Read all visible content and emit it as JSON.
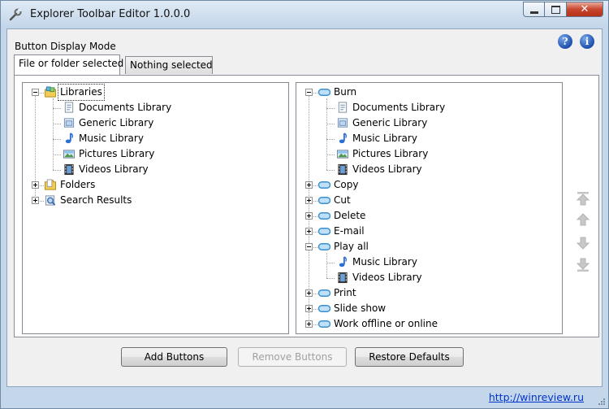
{
  "window": {
    "title": "Explorer Toolbar Editor 1.0.0.0"
  },
  "mode_label": "Button Display Mode",
  "tabs": [
    {
      "label": "File or folder selected",
      "active": true
    },
    {
      "label": "Nothing selected",
      "active": false
    }
  ],
  "left_tree": [
    {
      "label": "Libraries",
      "icon": "libraries-icon",
      "level": 0,
      "expanded": true,
      "selected": true
    },
    {
      "label": "Documents Library",
      "icon": "document-library-icon",
      "level": 1
    },
    {
      "label": "Generic Library",
      "icon": "generic-library-icon",
      "level": 1
    },
    {
      "label": "Music Library",
      "icon": "music-note-icon",
      "level": 1
    },
    {
      "label": "Pictures Library",
      "icon": "pictures-library-icon",
      "level": 1
    },
    {
      "label": "Videos Library",
      "icon": "film-icon",
      "level": 1
    },
    {
      "label": "Folders",
      "icon": "folder-icon",
      "level": 0,
      "expanded": false
    },
    {
      "label": "Search Results",
      "icon": "search-results-icon",
      "level": 0,
      "expanded": false
    }
  ],
  "right_tree": [
    {
      "label": "Burn",
      "icon": "toolbar-button-icon",
      "level": 0,
      "expanded": true
    },
    {
      "label": "Documents Library",
      "icon": "document-library-icon",
      "level": 1
    },
    {
      "label": "Generic Library",
      "icon": "generic-library-icon",
      "level": 1
    },
    {
      "label": "Music Library",
      "icon": "music-note-icon",
      "level": 1
    },
    {
      "label": "Pictures Library",
      "icon": "pictures-library-icon",
      "level": 1
    },
    {
      "label": "Videos Library",
      "icon": "film-icon",
      "level": 1
    },
    {
      "label": "Copy",
      "icon": "toolbar-button-icon",
      "level": 0,
      "expanded": false
    },
    {
      "label": "Cut",
      "icon": "toolbar-button-icon",
      "level": 0,
      "expanded": false
    },
    {
      "label": "Delete",
      "icon": "toolbar-button-icon",
      "level": 0,
      "expanded": false
    },
    {
      "label": "E-mail",
      "icon": "toolbar-button-icon",
      "level": 0,
      "expanded": false
    },
    {
      "label": "Play all",
      "icon": "toolbar-button-icon",
      "level": 0,
      "expanded": true
    },
    {
      "label": "Music Library",
      "icon": "music-note-icon",
      "level": 1
    },
    {
      "label": "Videos Library",
      "icon": "film-icon",
      "level": 1
    },
    {
      "label": "Print",
      "icon": "toolbar-button-icon",
      "level": 0,
      "expanded": false
    },
    {
      "label": "Slide show",
      "icon": "toolbar-button-icon",
      "level": 0,
      "expanded": false
    },
    {
      "label": "Work offline or online",
      "icon": "toolbar-button-icon",
      "level": 0,
      "expanded": false
    }
  ],
  "arrows": [
    {
      "name": "move-to-top-icon"
    },
    {
      "name": "move-up-icon"
    },
    {
      "name": "move-down-icon"
    },
    {
      "name": "move-to-bottom-icon"
    }
  ],
  "buttons": {
    "add": "Add Buttons",
    "remove": "Remove Buttons",
    "restore": "Restore Defaults"
  },
  "status": {
    "link": "http://winreview.ru"
  },
  "colors": {
    "title_bar": "#c4d7ea",
    "close_button": "#c7452c",
    "link": "#0033cc",
    "disabled_text": "#a0a0a0"
  }
}
